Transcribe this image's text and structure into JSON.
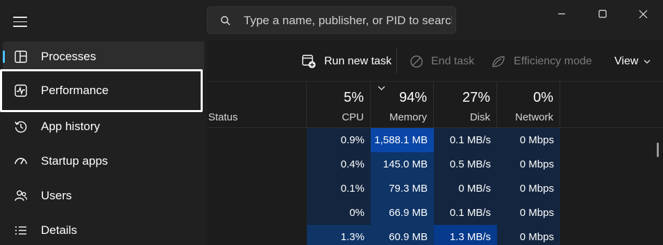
{
  "sidebar": {
    "items": [
      {
        "label": "Processes",
        "icon": "processes-icon",
        "state": "active"
      },
      {
        "label": "Performance",
        "icon": "performance-icon",
        "state": "focused"
      },
      {
        "label": "App history",
        "icon": "app-history-icon",
        "state": "normal"
      },
      {
        "label": "Startup apps",
        "icon": "startup-apps-icon",
        "state": "normal"
      },
      {
        "label": "Users",
        "icon": "users-icon",
        "state": "normal"
      },
      {
        "label": "Details",
        "icon": "details-icon",
        "state": "normal"
      }
    ]
  },
  "search": {
    "placeholder": "Type a name, publisher, or PID to search",
    "value": ""
  },
  "toolbar": {
    "run_new_task": "Run new task",
    "end_task": "End task",
    "efficiency_mode": "Efficiency mode",
    "view": "View"
  },
  "columns": {
    "status": "Status",
    "cpu": {
      "percent": "5%",
      "label": "CPU"
    },
    "memory": {
      "percent": "94%",
      "label": "Memory"
    },
    "disk": {
      "percent": "27%",
      "label": "Disk"
    },
    "network": {
      "percent": "0%",
      "label": "Network"
    }
  },
  "rows": [
    {
      "cpu": "0.9%",
      "memory": "1,588.1 MB",
      "disk": "0.1 MB/s",
      "network": "0 Mbps"
    },
    {
      "cpu": "0.4%",
      "memory": "145.0 MB",
      "disk": "0.5 MB/s",
      "network": "0 Mbps"
    },
    {
      "cpu": "0.1%",
      "memory": "79.3 MB",
      "disk": "0 MB/s",
      "network": "0 Mbps"
    },
    {
      "cpu": "0%",
      "memory": "66.9 MB",
      "disk": "0.1 MB/s",
      "network": "0 Mbps"
    },
    {
      "cpu": "1.3%",
      "memory": "60.9 MB",
      "disk": "1.3 MB/s",
      "network": "0 Mbps"
    }
  ],
  "heat_colors": {
    "low": "#14263f",
    "mid": "#0f3466",
    "high": "#063a8c",
    "highest": "#0a47a8"
  }
}
